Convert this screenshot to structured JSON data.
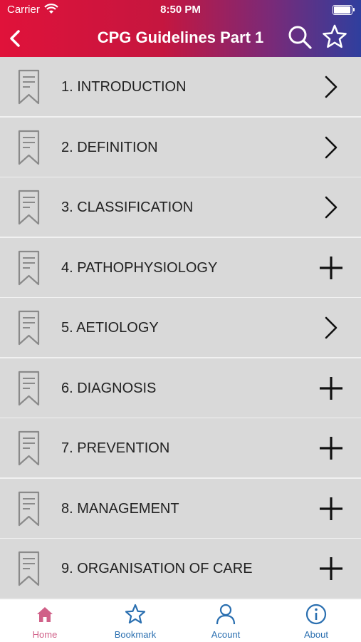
{
  "status_bar": {
    "carrier": "Carrier",
    "time": "8:50 PM"
  },
  "nav": {
    "title": "CPG Guidelines Part 1"
  },
  "items": [
    {
      "label": "1. INTRODUCTION",
      "action": "chevron-right"
    },
    {
      "label": "2. DEFINITION",
      "action": "chevron-right"
    },
    {
      "label": "3. CLASSIFICATION",
      "action": "chevron-right"
    },
    {
      "label": "4. PATHOPHYSIOLOGY",
      "action": "plus"
    },
    {
      "label": "5. AETIOLOGY",
      "action": "chevron-right"
    },
    {
      "label": "6. DIAGNOSIS",
      "action": "plus"
    },
    {
      "label": "7. PREVENTION",
      "action": "plus"
    },
    {
      "label": "8. MANAGEMENT",
      "action": "plus"
    },
    {
      "label": "9. ORGANISATION OF CARE",
      "action": "plus"
    }
  ],
  "tabs": [
    {
      "label": "Home",
      "icon": "home-icon"
    },
    {
      "label": "Bookmark",
      "icon": "star-icon"
    },
    {
      "label": "Acount",
      "icon": "user-icon"
    },
    {
      "label": "About",
      "icon": "info-icon"
    }
  ],
  "colors": {
    "active_tab": "#d06088",
    "inactive_tab": "#2a6fb0",
    "header_start": "#e0123a",
    "header_end": "#2f3f9e"
  }
}
